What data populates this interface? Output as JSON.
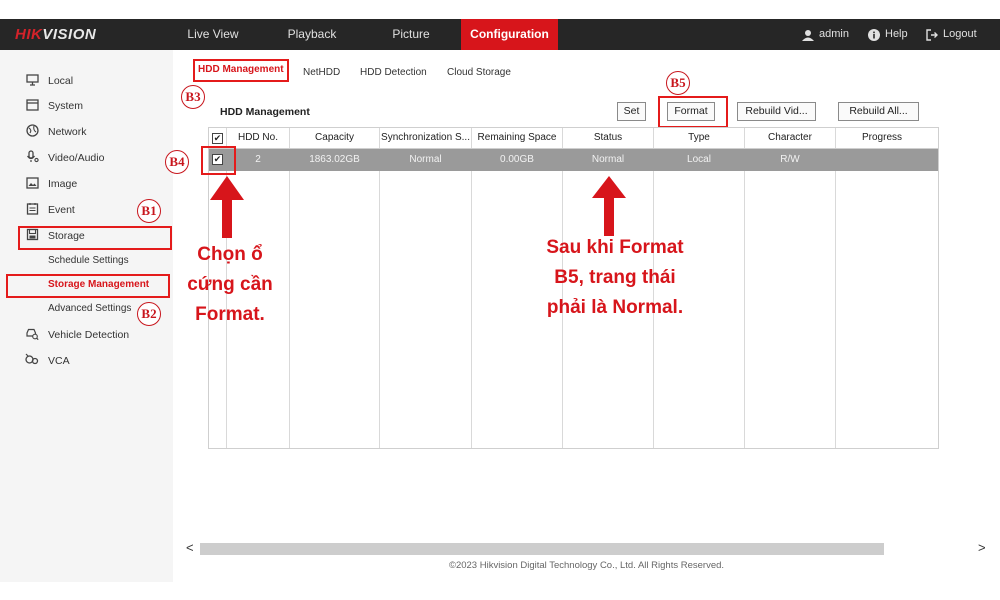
{
  "brand": {
    "prefix": "HIK",
    "suffix": "VISION"
  },
  "topnav": [
    {
      "label": "Live View"
    },
    {
      "label": "Playback"
    },
    {
      "label": "Picture"
    },
    {
      "label": "Configuration"
    }
  ],
  "topright": {
    "user": "admin",
    "help": "Help",
    "logout": "Logout"
  },
  "sidebar": {
    "items": [
      {
        "label": "Local",
        "icon": "monitor-icon"
      },
      {
        "label": "System",
        "icon": "window-icon"
      },
      {
        "label": "Network",
        "icon": "globe-icon"
      },
      {
        "label": "Video/Audio",
        "icon": "microphone-icon"
      },
      {
        "label": "Image",
        "icon": "image-icon"
      },
      {
        "label": "Event",
        "icon": "calendar-icon"
      },
      {
        "label": "Storage",
        "icon": "disk-icon"
      }
    ],
    "storage_sub": [
      "Schedule Settings",
      "Storage Management",
      "Advanced Settings"
    ],
    "more_items": [
      {
        "label": "Vehicle Detection",
        "icon": "vehicle-search-icon"
      },
      {
        "label": "VCA",
        "icon": "vca-icon"
      }
    ]
  },
  "tabs": [
    "HDD Management",
    "NetHDD",
    "HDD Detection",
    "Cloud Storage"
  ],
  "panel": {
    "title": "HDD Management",
    "buttons": {
      "set": "Set",
      "format": "Format",
      "rebuild_video": "Rebuild Vid...",
      "rebuild_all": "Rebuild All..."
    }
  },
  "table": {
    "headers": [
      "HDD No.",
      "Capacity",
      "Synchronization S...",
      "Remaining Space",
      "Status",
      "Type",
      "Character",
      "Progress"
    ],
    "rows": [
      {
        "hdd_no": "2",
        "capacity": "1863.02GB",
        "sync": "Normal",
        "remaining": "0.00GB",
        "status": "Normal",
        "type": "Local",
        "character": "R/W",
        "progress": ""
      }
    ]
  },
  "annotations": {
    "b1": "B1",
    "b2": "B2",
    "b3": "B3",
    "b4": "B4",
    "b5": "B5",
    "note_left": [
      "Chọn ổ",
      "cứng cần",
      "Format."
    ],
    "note_right": [
      "Sau khi Format",
      "B5, trang thái",
      "phải là Normal."
    ]
  },
  "footer": "©2023 Hikvision Digital Technology Co., Ltd. All Rights Reserved.",
  "colors": {
    "accent": "#d7151b",
    "topbar": "#262626",
    "row_selected": "#9a9a9a"
  }
}
